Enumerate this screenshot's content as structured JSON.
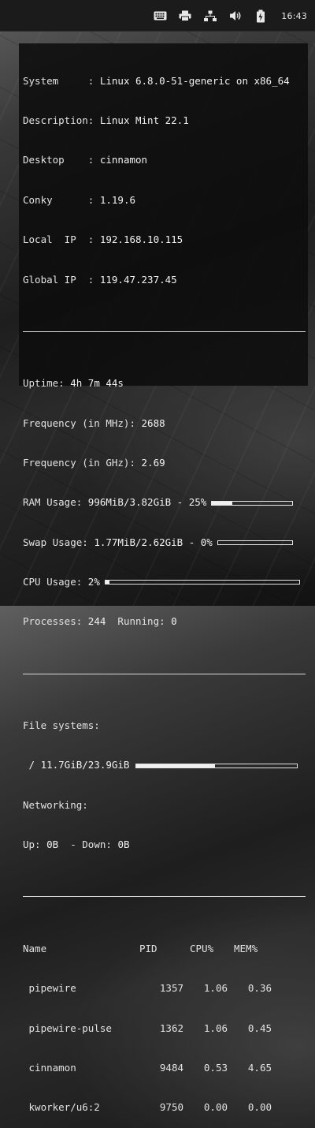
{
  "panel": {
    "clock": "16:43",
    "tray_icons": [
      "keyboard-icon",
      "printer-icon",
      "network-icon",
      "volume-icon",
      "battery-icon"
    ]
  },
  "conky": {
    "system_info": [
      {
        "label": "System     : ",
        "value": "Linux 6.8.0-51-generic on x86_64"
      },
      {
        "label": "Description: ",
        "value": "Linux Mint 22.1"
      },
      {
        "label": "Desktop    : ",
        "value": "cinnamon"
      },
      {
        "label": "Conky      : ",
        "value": "1.19.6"
      },
      {
        "label": "Local  IP  : ",
        "value": "192.168.10.115"
      },
      {
        "label": "Global IP  : ",
        "value": "119.47.237.45"
      }
    ],
    "uptime": {
      "label": "Uptime: ",
      "value": "4h 7m 44s"
    },
    "freq_mhz": {
      "label": "Frequency (in MHz): ",
      "value": "2688"
    },
    "freq_ghz": {
      "label": "Frequency (in GHz): ",
      "value": "2.69"
    },
    "ram": {
      "label": "RAM Usage: ",
      "value": "996MiB/3.82GiB - 25%",
      "fraction": 0.25
    },
    "swap": {
      "label": "Swap Usage: ",
      "value": "1.77MiB/2.62GiB - 0%",
      "fraction": 0.0
    },
    "cpu": {
      "label": "CPU Usage: ",
      "value": "2%",
      "fraction": 0.02
    },
    "processes": {
      "label": "Processes: ",
      "value": "244",
      "running_label": "  Running: ",
      "running_value": "0"
    },
    "filesystems": {
      "title": "File systems:",
      "root": " / 11.7GiB/23.9GiB",
      "fraction": 0.49
    },
    "networking": {
      "title": "Networking:",
      "up_label": "Up: ",
      "up_value": "0B",
      "down_label": "  - Down: ",
      "down_value": "0B"
    },
    "process_table": {
      "headers": {
        "name": "Name",
        "pid": "PID",
        "cpu": "CPU%",
        "mem": "MEM%"
      },
      "rows": [
        {
          "name": " pipewire",
          "pid": "1357",
          "cpu": "1.06",
          "mem": "0.36"
        },
        {
          "name": " pipewire-pulse",
          "pid": "1362",
          "cpu": "1.06",
          "mem": "0.45"
        },
        {
          "name": " cinnamon",
          "pid": "9484",
          "cpu": "0.53",
          "mem": "4.65"
        },
        {
          "name": " kworker/u6:2",
          "pid": "9750",
          "cpu": "0.00",
          "mem": "0.00"
        }
      ]
    }
  }
}
